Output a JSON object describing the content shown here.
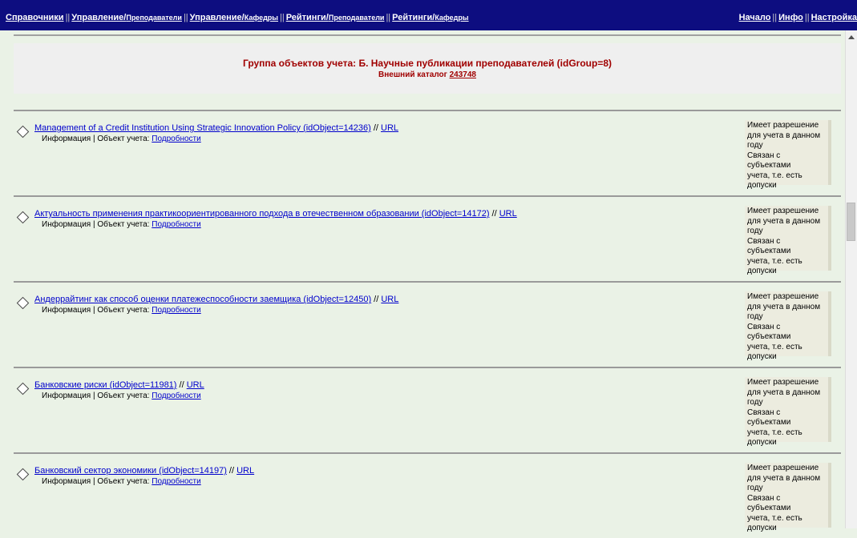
{
  "nav": {
    "left": [
      {
        "main": "Справочники",
        "sub": ""
      },
      {
        "main": "Управление/",
        "sub": "Преподаватели"
      },
      {
        "main": "Управление/",
        "sub": "Кафедры"
      },
      {
        "main": "Рейтинги/",
        "sub": "Преподаватели"
      },
      {
        "main": "Рейтинги/",
        "sub": "Кафедры"
      }
    ],
    "right": [
      "Начало",
      "Инфо",
      "Настройка"
    ],
    "separator": "||"
  },
  "header": {
    "title": "Группа объектов учета: Б. Научные публикации преподавателей (idGroup=8)",
    "catalog_label": "Внешний каталог",
    "catalog_value": "243748"
  },
  "items": [
    {
      "title": "Management of a Credit Institution Using Strategic Innovation Policy (idObject=14236)",
      "sep": " // ",
      "url": "URL",
      "info_text": "Информация | Объект учета:",
      "details": "Подробности",
      "status_lines": [
        "Имеет разрешение",
        "для учета в данном",
        "году",
        "Связан с субъектами",
        "учета, т.е. есть",
        "допуски"
      ]
    },
    {
      "title": "Актуальность применения практикоориентированного подхода в отечественном образовании (idObject=14172)",
      "sep": " // ",
      "url": "URL",
      "info_text": "Информация | Объект учета:",
      "details": "Подробности",
      "status_lines": [
        "Имеет разрешение",
        "для учета в данном",
        "году",
        "Связан с субъектами",
        "учета, т.е. есть",
        "допуски"
      ]
    },
    {
      "title": "Андеррайтинг как способ оценки платежеспособности заемщика (idObject=12450)",
      "sep": " // ",
      "url": "URL",
      "info_text": "Информация | Объект учета:",
      "details": "Подробности",
      "status_lines": [
        "Имеет разрешение",
        "для учета в данном",
        "году",
        "Связан с субъектами",
        "учета, т.е. есть",
        "допуски"
      ]
    },
    {
      "title": "Банковские риски (idObject=11981)",
      "sep": " // ",
      "url": "URL",
      "info_text": "Информация | Объект учета:",
      "details": "Подробности",
      "status_lines": [
        "Имеет разрешение",
        "для учета в данном",
        "году",
        "Связан с субъектами",
        "учета, т.е. есть",
        "допуски"
      ]
    },
    {
      "title": "Банковский сектор экономики (idObject=14197)",
      "sep": " // ",
      "url": "URL",
      "info_text": "Информация | Объект учета:",
      "details": "Подробности",
      "status_lines": [
        "Имеет разрешение",
        "для учета в данном",
        "году",
        "Связан с субъектами",
        "учета, т.е. есть",
        "допуски"
      ]
    }
  ]
}
